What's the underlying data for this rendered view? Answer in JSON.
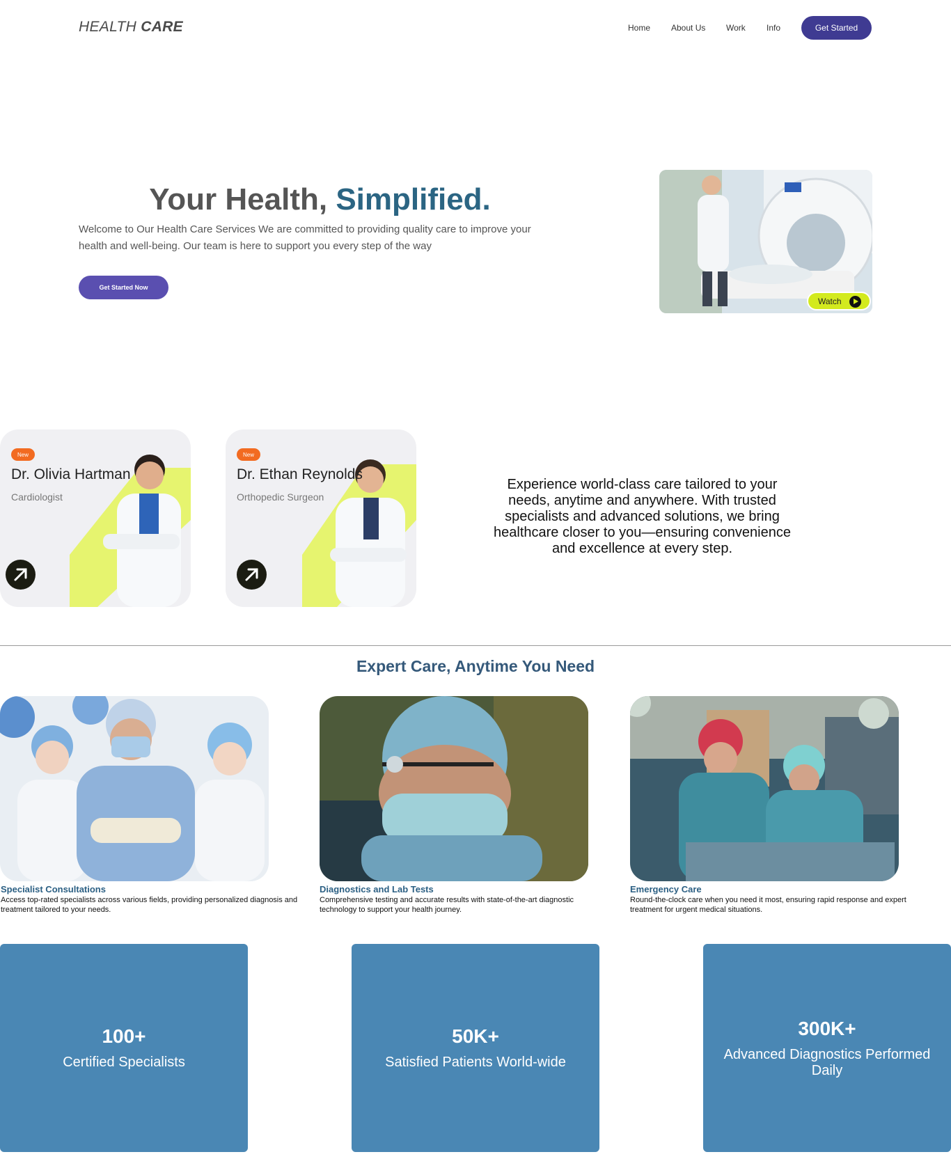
{
  "nav": {
    "logo_light": "HEALTH ",
    "logo_bold": "CARE",
    "links": [
      "Home",
      "About Us",
      "Work",
      "Info"
    ],
    "cta_label": "Get Started"
  },
  "hero": {
    "title_plain": "Your Health, ",
    "title_accent": "Simplified.",
    "description": "Welcome to Our Health Care Services We are committed to providing quality care to improve your health and well-being. Our team is here to support you every step of the way",
    "cta_label": "Get Started Now",
    "watch_label": "Watch"
  },
  "doctors": [
    {
      "badge": "New",
      "name": "Dr. Olivia Hartman",
      "specialty": "Cardiologist"
    },
    {
      "badge": "New",
      "name": "Dr. Ethan Reynolds",
      "specialty": "Orthopedic Surgeon"
    }
  ],
  "experience_text": "Experience world-class care tailored to your needs, anytime and anywhere. With trusted specialists and advanced solutions, we bring healthcare closer to you—ensuring convenience and excellence at every step.",
  "services_title": "Expert Care, Anytime You Need",
  "services": [
    {
      "title": "Specialist Consultations",
      "description": "Access top-rated specialists across various fields, providing personalized diagnosis and treatment tailored to your needs."
    },
    {
      "title": "Diagnostics and Lab Tests",
      "description": "Comprehensive testing and accurate results with state-of-the-art diagnostic technology to support your health journey."
    },
    {
      "title": "Emergency Care",
      "description": "Round-the-clock care when you need it most, ensuring rapid response and expert treatment for urgent medical situations."
    }
  ],
  "stats": [
    {
      "value": "100+",
      "label": "Certified Specialists"
    },
    {
      "value": "50K+",
      "label": "Satisfied Patients World-wide"
    },
    {
      "value": "300K+",
      "label": "Advanced Diagnostics Performed Daily"
    }
  ],
  "colors": {
    "primary": "#3f3b92",
    "accent_text": "#2b6583",
    "stat_bg": "#4a87b4",
    "badge": "#f26b21",
    "lime": "#d3ea1e"
  }
}
